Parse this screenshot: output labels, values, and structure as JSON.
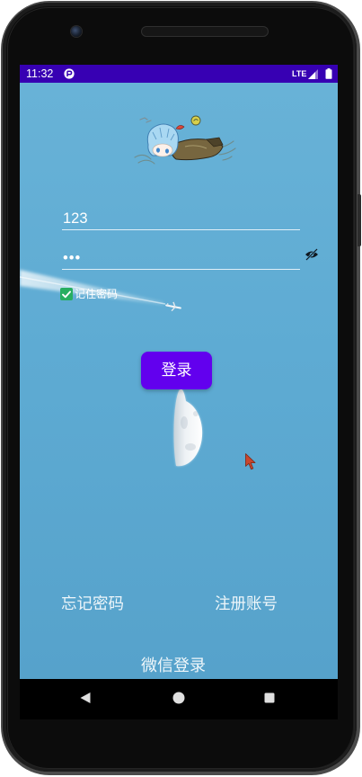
{
  "status_bar": {
    "time": "11:32",
    "network": "LTE",
    "icons": [
      "app-notification-icon",
      "signal-icon",
      "battery-icon"
    ]
  },
  "login_form": {
    "username": {
      "value": "123"
    },
    "password": {
      "value": "•••",
      "visibility_icon": "eye-off-icon"
    },
    "remember_password": {
      "label": "记住密码",
      "checked": true
    },
    "submit_label": "登录"
  },
  "links": {
    "forgot_password": "忘记密码",
    "register": "注册账号",
    "wechat_login": "微信登录"
  },
  "nav_bar": {
    "icons": [
      "back-icon",
      "home-icon",
      "recents-icon"
    ]
  },
  "colors": {
    "status_bar": "#3700b3",
    "accent": "#6200ee",
    "checkbox": "#27ae60",
    "sky": "#5eabd3",
    "text": "#ffffff"
  }
}
